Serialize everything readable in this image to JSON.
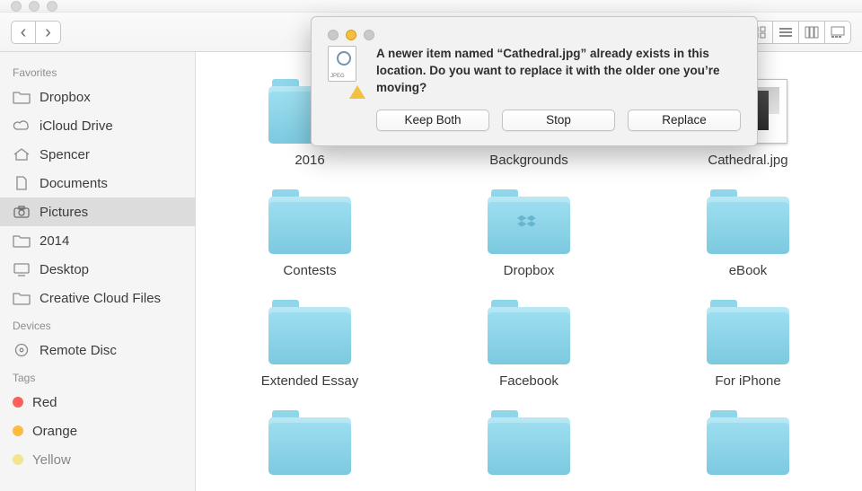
{
  "toolbar": {
    "back_glyph": "‹",
    "forward_glyph": "›"
  },
  "sidebar": {
    "sections": {
      "favorites": "Favorites",
      "devices": "Devices",
      "tags": "Tags"
    },
    "favorites": [
      {
        "label": "Dropbox",
        "icon": "folder"
      },
      {
        "label": "iCloud Drive",
        "icon": "cloud"
      },
      {
        "label": "Spencer",
        "icon": "home"
      },
      {
        "label": "Documents",
        "icon": "doc"
      },
      {
        "label": "Pictures",
        "icon": "camera",
        "selected": true
      },
      {
        "label": "2014",
        "icon": "folder"
      },
      {
        "label": "Desktop",
        "icon": "desktop"
      },
      {
        "label": "Creative Cloud Files",
        "icon": "folder"
      }
    ],
    "devices": [
      {
        "label": "Remote Disc",
        "icon": "disc"
      }
    ],
    "tags": [
      {
        "label": "Red",
        "color": "#fc605b"
      },
      {
        "label": "Orange",
        "color": "#fdbc40"
      },
      {
        "label": "Yellow",
        "color": "#f3d94a"
      }
    ]
  },
  "grid": [
    {
      "label": "2016",
      "type": "folder"
    },
    {
      "label": "Backgrounds",
      "type": "folder"
    },
    {
      "label": "Cathedral.jpg",
      "type": "image"
    },
    {
      "label": "Contests",
      "type": "folder"
    },
    {
      "label": "Dropbox",
      "type": "folder",
      "mark": "dropbox"
    },
    {
      "label": "eBook",
      "type": "folder"
    },
    {
      "label": "Extended Essay",
      "type": "folder"
    },
    {
      "label": "Facebook",
      "type": "folder"
    },
    {
      "label": "For iPhone",
      "type": "folder"
    },
    {
      "label": "",
      "type": "folder"
    },
    {
      "label": "",
      "type": "folder"
    },
    {
      "label": "",
      "type": "folder"
    }
  ],
  "dialog": {
    "message": "A newer item named “Cathedral.jpg” already exists in this location. Do you want to replace it with the older one you’re moving?",
    "buttons": {
      "keep": "Keep Both",
      "stop": "Stop",
      "replace": "Replace"
    }
  }
}
